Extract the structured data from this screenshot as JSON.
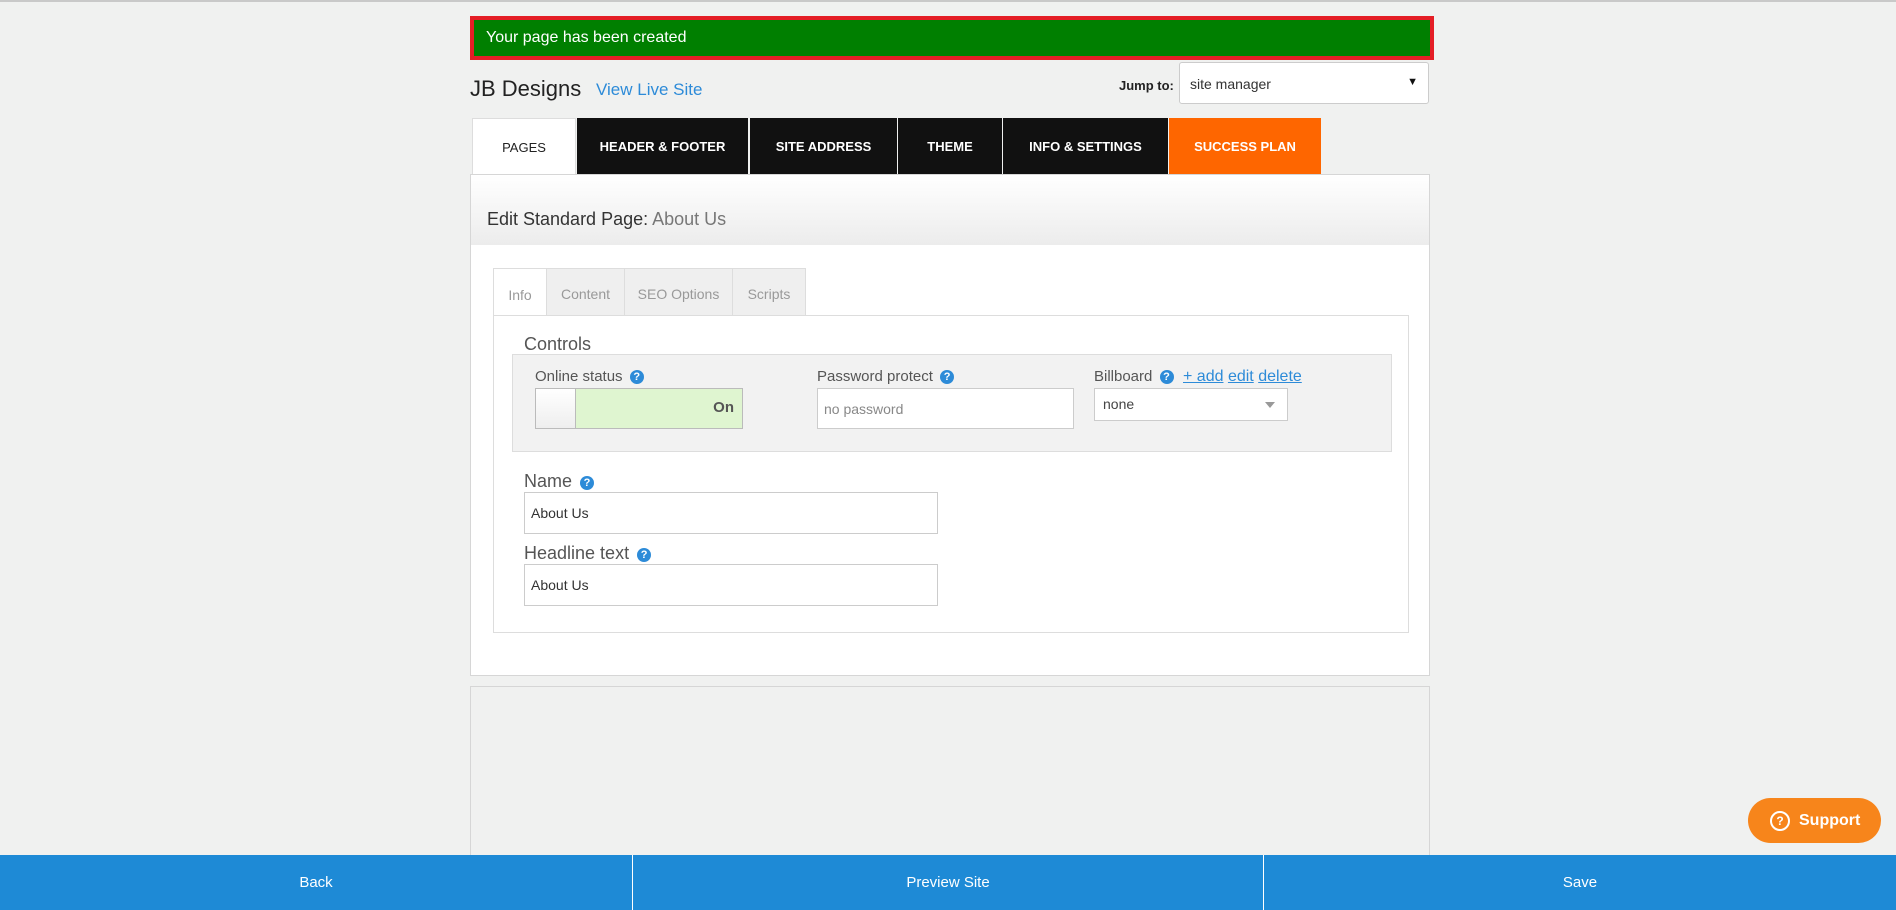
{
  "flash": {
    "message": "Your page has been created"
  },
  "header": {
    "site_name": "JB Designs",
    "view_live_label": "View Live Site",
    "jump_label": "Jump to:",
    "jump_value": "site manager"
  },
  "main_tabs": [
    {
      "label": "PAGES",
      "active": true
    },
    {
      "label": "HEADER & FOOTER"
    },
    {
      "label": "SITE ADDRESS"
    },
    {
      "label": "THEME"
    },
    {
      "label": "INFO & SETTINGS"
    },
    {
      "label": "SUCCESS PLAN",
      "color": "#fe6600"
    }
  ],
  "panel": {
    "heading_prefix": "Edit Standard Page:",
    "page_name": "About Us"
  },
  "sub_tabs": [
    {
      "label": "Info",
      "active": true
    },
    {
      "label": "Content"
    },
    {
      "label": "SEO Options"
    },
    {
      "label": "Scripts"
    }
  ],
  "controls": {
    "title": "Controls",
    "online_status_label": "Online status",
    "online_status_value": "On",
    "password_label": "Password protect",
    "password_placeholder": "no password",
    "billboard_label": "Billboard",
    "billboard_add": "+ add",
    "billboard_edit": "edit",
    "billboard_delete": "delete",
    "billboard_value": "none"
  },
  "fields": {
    "name_label": "Name",
    "name_value": "About Us",
    "headline_label": "Headline text",
    "headline_value": "About Us"
  },
  "support": {
    "label": "Support"
  },
  "bottom_bar": {
    "back": "Back",
    "preview": "Preview Site",
    "save": "Save"
  },
  "colors": {
    "flash_bg": "#007f00",
    "flash_border": "#e41e26",
    "accent": "#1e8ad6",
    "orange": "#fe6600",
    "support": "#f7851b"
  }
}
